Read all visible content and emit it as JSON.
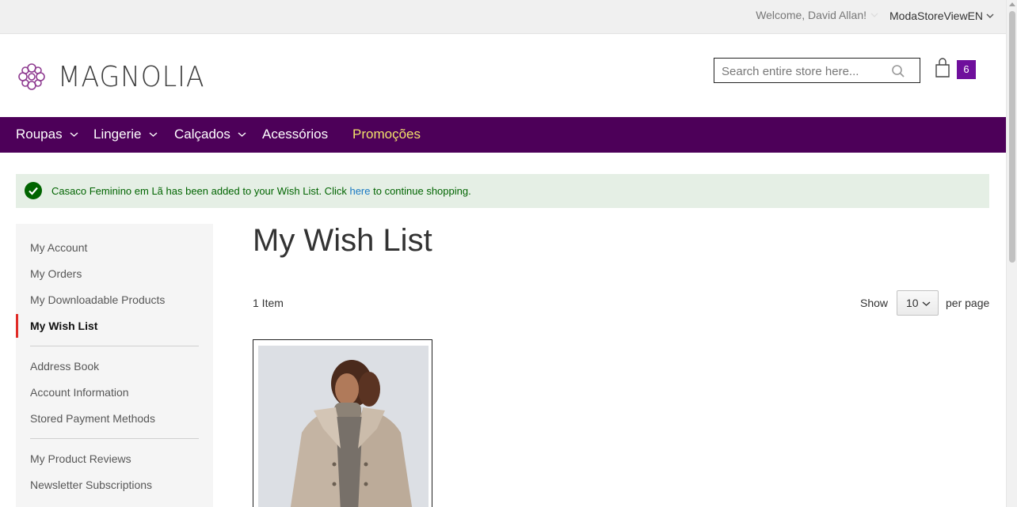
{
  "header": {
    "welcome": "Welcome, David Allan!",
    "store_view": "ModaStoreViewEN",
    "logo_text": "MAGNOLIA",
    "search_placeholder": "Search entire store here...",
    "cart_count": "6"
  },
  "nav": {
    "items": [
      {
        "label": "Roupas"
      },
      {
        "label": "Lingerie"
      },
      {
        "label": "Calçados"
      },
      {
        "label": "Acessórios"
      },
      {
        "label": "Promoções"
      }
    ]
  },
  "message": {
    "text_before": "Casaco Feminino em Lã has been added to your Wish List. Click ",
    "link": "here",
    "text_after": " to continue shopping."
  },
  "sidebar": {
    "items": [
      {
        "label": "My Account"
      },
      {
        "label": "My Orders"
      },
      {
        "label": "My Downloadable Products"
      },
      {
        "label": "My Wish List"
      },
      {
        "label": "Address Book"
      },
      {
        "label": "Account Information"
      },
      {
        "label": "Stored Payment Methods"
      },
      {
        "label": "My Product Reviews"
      },
      {
        "label": "Newsletter Subscriptions"
      }
    ],
    "current": "My Wish List"
  },
  "main": {
    "title": "My Wish List",
    "item_count": "1 Item",
    "show_label": "Show",
    "limiter_value": "10",
    "per_page_label": "per page"
  },
  "colors": {
    "nav_bg": "#4d0059",
    "promo": "#f2e16b",
    "cart_badge": "#6f0f9c",
    "success_bg": "#e5efe5",
    "success_text": "#006400",
    "current_marker": "#e02b27",
    "logo": "#8e3b90"
  }
}
